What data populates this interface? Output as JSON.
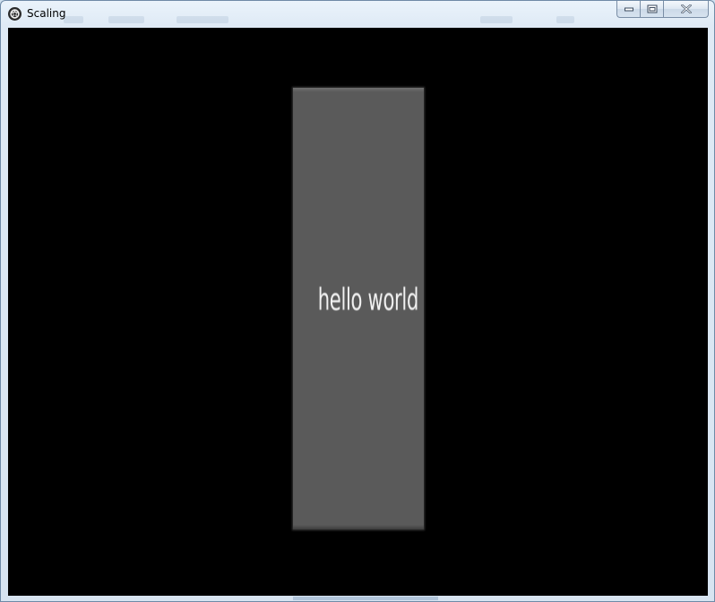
{
  "window": {
    "title": "Scaling",
    "app_icon": "gear-icon",
    "caption_buttons": {
      "minimize_icon": "minimize-icon",
      "maximize_icon": "maximize-icon",
      "close_icon": "close-icon"
    }
  },
  "canvas": {
    "background": "#000000",
    "panel": {
      "color": "#5a5a5a",
      "text": "hello world",
      "text_color": "#f2f2f2"
    }
  }
}
